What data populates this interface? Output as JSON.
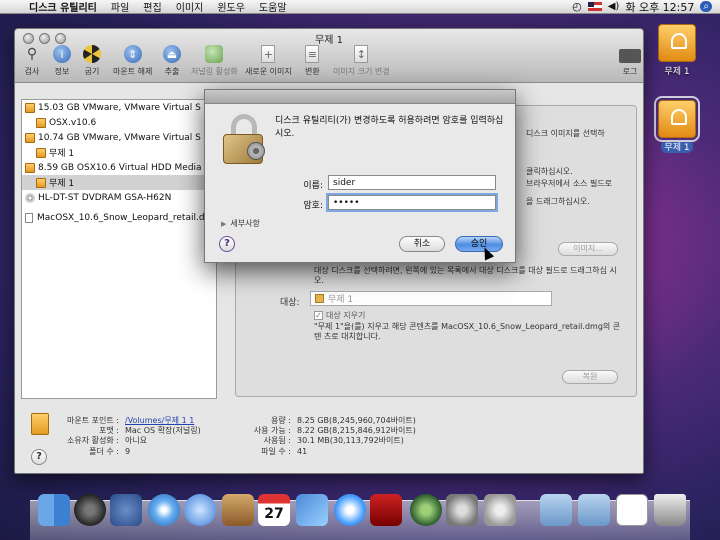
{
  "menubar": {
    "app": "디스크 유틸리티",
    "items": [
      "파일",
      "편집",
      "이미지",
      "윈도우",
      "도움말"
    ],
    "clock": "화 오후 12:57"
  },
  "desktop": {
    "icons": [
      {
        "label": "무제 1"
      },
      {
        "label": "무제 1"
      }
    ]
  },
  "window": {
    "title": "무제 1",
    "toolbar": [
      "검사",
      "정보",
      "굽기",
      "마운트 해제",
      "추출",
      "저널링 활성화",
      "새로운 이미지",
      "변환",
      "이미지 크기 변경",
      "로그"
    ]
  },
  "sidebar": {
    "items": [
      {
        "label": "15.03 GB VMware, VMware Virtual S Media",
        "level": 0,
        "icon": "disk"
      },
      {
        "label": "OSX.v10.6",
        "level": 1,
        "icon": "disk"
      },
      {
        "label": "10.74 GB VMware, VMware Virtual S Media",
        "level": 0,
        "icon": "disk"
      },
      {
        "label": "무제 1",
        "level": 1,
        "icon": "disk"
      },
      {
        "label": "8.59 GB OSX10.6 Virtual HDD Media",
        "level": 0,
        "icon": "disk"
      },
      {
        "label": "무제 1",
        "level": 1,
        "icon": "disk",
        "selected": true
      },
      {
        "label": "HL-DT-ST DVDRAM GSA-H62N",
        "level": 0,
        "icon": "cd"
      },
      {
        "label": "MacOSX_10.6_Snow_Leopard_retail.dmg",
        "level": 0,
        "icon": "image",
        "gap": true
      }
    ]
  },
  "restore": {
    "text1": "디스크 이미지를 선택하",
    "text2": "클릭하십시오.",
    "text3": "브라우저에서 소스 필드로",
    "text4": "을 드래그하십시오.",
    "image_btn": "이미지...",
    "target_text_a": "대상 디스크를 선택하려면, 왼쪽에 있는 목록에서 대상 디스크를 대상 필드로 드래그하십",
    "target_text_b": "시오.",
    "target_label": "대상:",
    "target_value": "무제 1",
    "erase_label": "대상 지우기",
    "erase_desc_a": "\"무제 1\"을(를) 지우고 해당 콘텐츠를 MacOSX_10.6_Snow_Leopard_retail.dmg의 콘텐",
    "erase_desc_b": "츠로 대치합니다.",
    "restore_btn": "복원"
  },
  "info": {
    "left": [
      {
        "k": "마운트 포인트 :",
        "v": "/Volumes/무제 1 1"
      },
      {
        "k": "포맷 :",
        "v": "Mac OS 확장(저널링)"
      },
      {
        "k": "소유자 활성화 :",
        "v": "아니요"
      },
      {
        "k": "폴더 수 :",
        "v": "9"
      }
    ],
    "right": [
      {
        "k": "용량 :",
        "v": "8.25 GB(8,245,960,704바이트)"
      },
      {
        "k": "사용 가능 :",
        "v": "8.22 GB(8,215,846,912바이트)"
      },
      {
        "k": "사용됨 :",
        "v": "30.1 MB(30,113,792바이트)"
      },
      {
        "k": "파일 수 :",
        "v": "41"
      }
    ]
  },
  "dialog": {
    "message": "디스크 유틸리티(가) 변경하도록 허용하려면 암호를 입력하십시오.",
    "name_label": "이름:",
    "name_value": "sider",
    "password_label": "암호:",
    "password_value": "•••••",
    "details": "세부사항",
    "cancel": "취소",
    "ok": "승인"
  },
  "help_glyph": "?",
  "apple_glyph": "",
  "colors": {
    "accent": "#4f8de0",
    "disk": "#e28b14"
  }
}
